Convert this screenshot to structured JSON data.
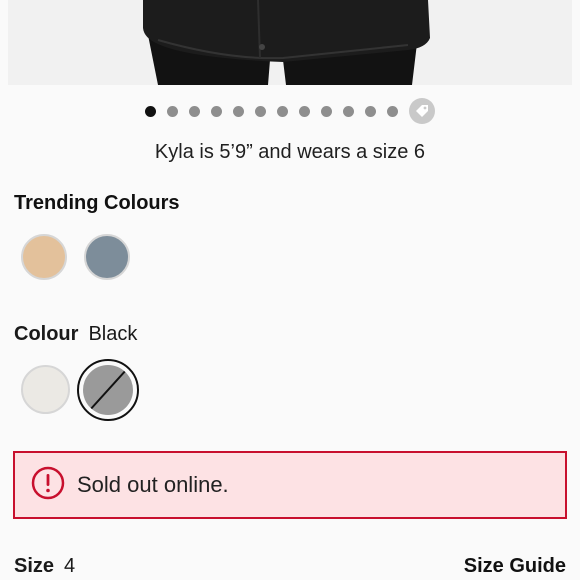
{
  "gallery": {
    "dot_count": 12,
    "active_index": 0,
    "extra_icon": "price-tag-icon"
  },
  "model_note": "Kyla is 5’9” and wears a size 6",
  "trending": {
    "title": "Trending Colours",
    "swatches": [
      {
        "color": "#e3c19b"
      },
      {
        "color": "#7d8d9a"
      }
    ]
  },
  "colour": {
    "label": "Colour",
    "selected": "Black",
    "swatches": [
      {
        "color": "#ebe9e4"
      },
      {
        "color": "#9a9a9a",
        "unavailable": true
      }
    ]
  },
  "alert": {
    "text": "Sold out online.",
    "border_color": "#c8102e",
    "bg_color": "#fde2e4",
    "icon": "alert-circle-icon"
  },
  "size": {
    "label": "Size",
    "value": "4",
    "guide_label": "Size Guide"
  }
}
